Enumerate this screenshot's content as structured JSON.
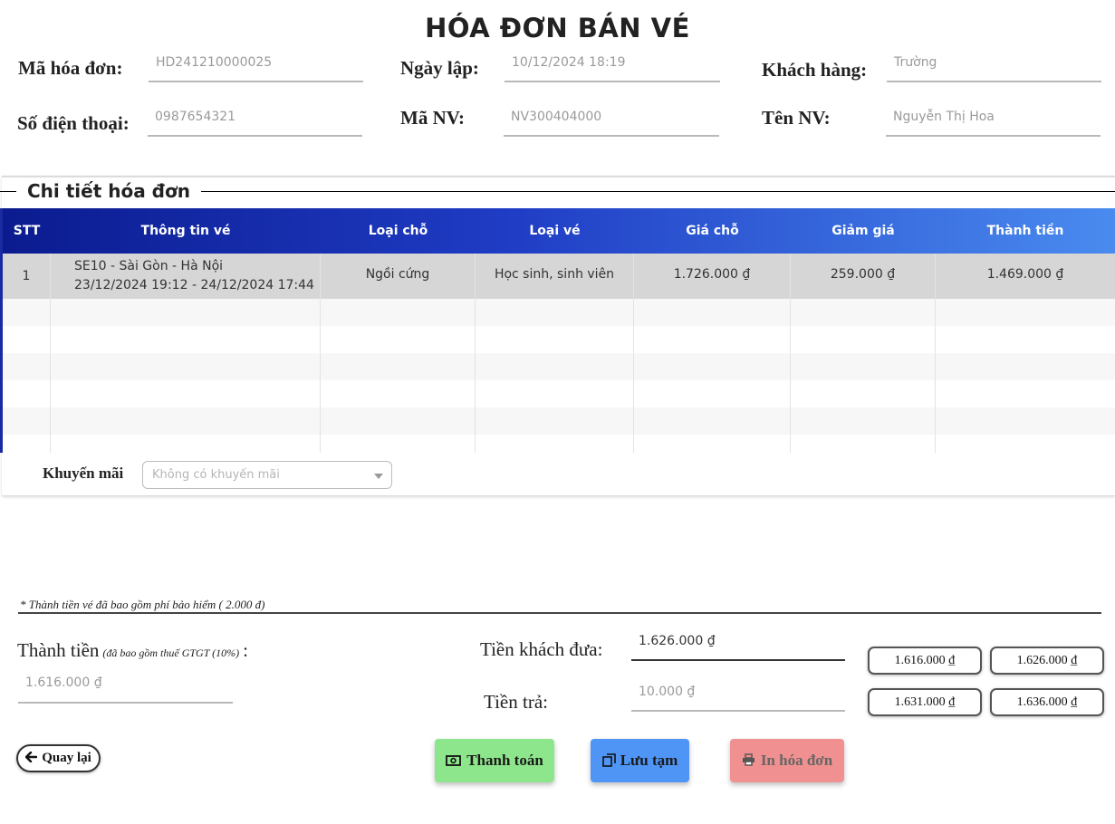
{
  "title": "HÓA ĐƠN BÁN VÉ",
  "info": {
    "invoice_code_label": "Mã hóa đơn:",
    "invoice_code_value": "HD241210000025",
    "date_label": "Ngày lập:",
    "date_value": "10/12/2024 18:19",
    "customer_label": "Khách hàng:",
    "customer_value": "Trường",
    "phone_label": "Số điện thoại:",
    "phone_value": "0987654321",
    "staff_id_label": "Mã NV:",
    "staff_id_value": "NV300404000",
    "staff_name_label": "Tên NV:",
    "staff_name_value": "Nguyễn Thị Hoa"
  },
  "details": {
    "section_title": "Chi tiết hóa đơn",
    "columns": [
      "STT",
      "Thông tin vé",
      "Loại chỗ",
      "Loại vé",
      "Giá chỗ",
      "Giảm giá",
      "Thành tiền"
    ],
    "rows": [
      {
        "stt": "1",
        "info_line1": "SE10 - Sài Gòn - Hà Nội",
        "info_line2": "23/12/2024 19:12 - 24/12/2024 17:44",
        "seat_type": "Ngồi cứng",
        "ticket_type": "Học sinh, sinh viên",
        "seat_price": "1.726.000 ₫",
        "discount": "259.000 ₫",
        "total": "1.469.000 ₫"
      }
    ]
  },
  "promotion": {
    "label": "Khuyến mãi",
    "selected": "Không có khuyến mãi"
  },
  "note": "* Thành tiền vé đã bao gồm phí bảo hiểm ( 2.000 đ)",
  "payment": {
    "total_label": "Thành tiền",
    "total_sub": "(đã bao gồm thuế GTGT (10%)",
    "total_colon": ":",
    "total_value": "1.616.000 ₫",
    "given_label": "Tiền khách đưa:",
    "given_value": "1.626.000 ₫",
    "change_label": "Tiền trả:",
    "change_value": "10.000 ₫",
    "quick_amounts": [
      "1.616.000 ₫",
      "1.626.000 ₫",
      "1.631.000 ₫",
      "1.636.000 ₫"
    ]
  },
  "actions": {
    "back": "Quay lại",
    "pay": "Thanh toán",
    "save": "Lưu tạm",
    "print": "In hóa đơn"
  },
  "colors": {
    "header_gradient_start": "#0b1b8f",
    "header_gradient_end": "#4a8bef",
    "pay_button": "#8ee68c",
    "save_button": "#4f95f5",
    "print_button": "#f09090"
  }
}
